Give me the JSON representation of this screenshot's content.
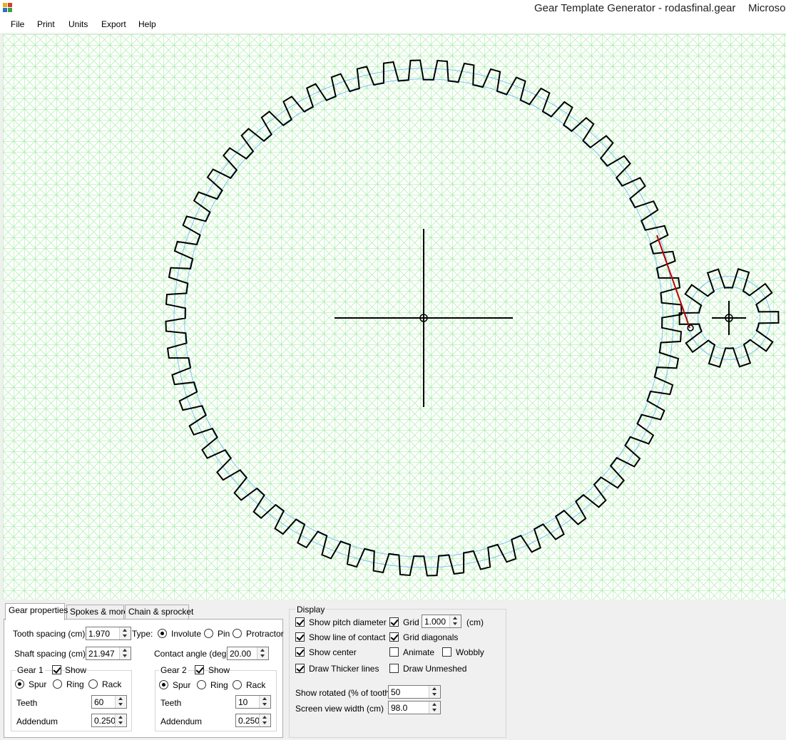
{
  "window": {
    "title": "Gear Template Generator - rodasfinal.gear",
    "title_tail": "Microso"
  },
  "menu": {
    "items": [
      "File",
      "Print",
      "Units",
      "Export",
      "Help"
    ]
  },
  "tabs": [
    "Gear properties",
    "Spokes & more",
    "Chain & sprocket"
  ],
  "gear_properties": {
    "tooth_spacing_label": "Tooth spacing (cm)",
    "tooth_spacing_value": "1.970",
    "type_label": "Type:",
    "type_options": [
      "Involute",
      "Pin",
      "Protractor"
    ],
    "type_selected": "Involute",
    "shaft_spacing_label": "Shaft spacing (cm)",
    "shaft_spacing_value": "21.947",
    "contact_angle_label": "Contact angle (deg)",
    "contact_angle_value": "20.00",
    "gear1": {
      "title": "Gear 1",
      "show_label": "Show",
      "show_checked": true,
      "options": [
        "Spur",
        "Ring",
        "Rack"
      ],
      "selected": "Spur",
      "teeth_label": "Teeth",
      "teeth_value": "60",
      "addendum_label": "Addendum",
      "addendum_value": "0.250"
    },
    "gear2": {
      "title": "Gear 2",
      "show_label": "Show",
      "show_checked": true,
      "options": [
        "Spur",
        "Ring",
        "Rack"
      ],
      "selected": "Spur",
      "teeth_label": "Teeth",
      "teeth_value": "10",
      "addendum_label": "Addendum",
      "addendum_value": "0.250"
    }
  },
  "display": {
    "title": "Display",
    "show_pitch_diameter_label": "Show pitch diameter",
    "show_pitch_diameter": true,
    "show_line_of_contact_label": "Show line of contact",
    "show_line_of_contact": true,
    "show_center_label": "Show center",
    "show_center": true,
    "draw_thicker_lines_label": "Draw Thicker lines",
    "draw_thicker_lines": true,
    "grid_label": "Grid",
    "grid": true,
    "grid_value": "1.000",
    "grid_unit": "(cm)",
    "grid_diagonals_label": "Grid diagonals",
    "grid_diagonals": true,
    "animate_label": "Animate",
    "animate": false,
    "wobbly_label": "Wobbly",
    "wobbly": false,
    "draw_unmeshed_label": "Draw Unmeshed",
    "draw_unmeshed": false,
    "show_rotated_label": "Show rotated (% of tooth)",
    "show_rotated_value": "50",
    "screen_view_width_label": "Screen view width (cm)",
    "screen_view_width_value": "98.0"
  },
  "colors": {
    "grid": "#90e890",
    "pitch_circle": "#7fc4f0",
    "gear_outline": "#000000",
    "contact_line": "#c00000"
  }
}
